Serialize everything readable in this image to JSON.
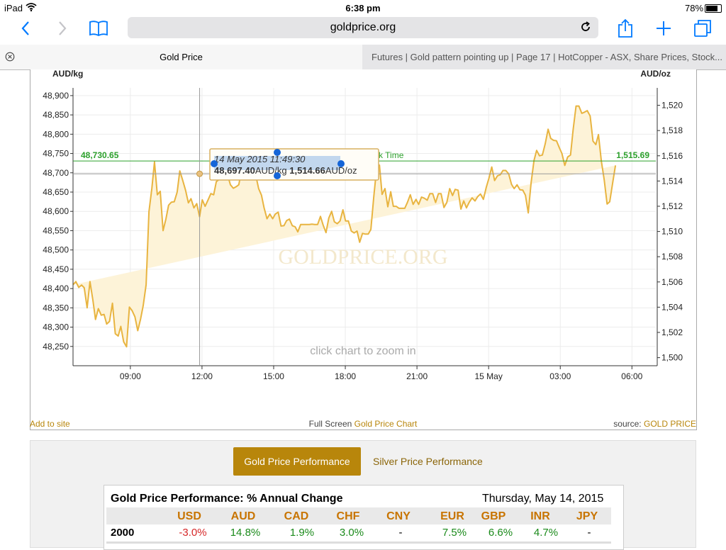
{
  "status_bar": {
    "carrier": "iPad",
    "time": "6:38 pm",
    "battery": "78%",
    "battery_level": 0.78
  },
  "browser": {
    "url": "goldprice.org",
    "tabs": [
      {
        "title": "Gold Price",
        "active": true
      },
      {
        "title": "Futures | Gold pattern pointing up | Page 17 | HotCopper - ASX, Share Prices, Stock...",
        "active": false
      }
    ]
  },
  "icons": {
    "back": "chevron-left-icon",
    "forward": "chevron-right-icon",
    "bookmarks": "book-icon",
    "reload": "reload-icon",
    "share": "share-icon",
    "new_tab": "plus-icon",
    "tabs": "tabs-icon",
    "close_tab": "close-icon",
    "wifi": "wifi-icon",
    "battery": "battery-icon"
  },
  "colors": {
    "accent": "#007aff",
    "gold_line": "#e8b440",
    "gold_fill": "#fdf3d8",
    "gold_brand": "#b8860b",
    "level_green": "#2ca02c",
    "marker_blue": "#1565d8"
  },
  "chart_data": {
    "type": "area",
    "left_axis_label": "AUD/kg",
    "right_axis_label": "AUD/oz",
    "ylim_left": [
      48200,
      48920
    ],
    "ylim_right": [
      1499.36,
      1521.38
    ],
    "y_ticks_left": [
      "48,250",
      "48,300",
      "48,350",
      "48,400",
      "48,450",
      "48,500",
      "48,550",
      "48,600",
      "48,650",
      "48,700",
      "48,750",
      "48,800",
      "48,850",
      "48,900"
    ],
    "y_ticks_right": [
      "1,500",
      "1,502",
      "1,504",
      "1,506",
      "1,508",
      "1,510",
      "1,512",
      "1,514",
      "1,516",
      "1,518",
      "1,520"
    ],
    "x_tick_labels": [
      "09:00",
      "12:00",
      "15:00",
      "18:00",
      "21:00",
      "15 May",
      "03:00",
      "06:00"
    ],
    "x_tick_hours": [
      9,
      12,
      15,
      18,
      21,
      24,
      27,
      30
    ],
    "xlim_hours": [
      6.6,
      31.0
    ],
    "series": [
      {
        "x_hours": [
          6.6,
          6.72,
          6.84,
          6.96,
          7.07,
          7.19,
          7.31,
          7.43,
          7.54,
          7.66,
          7.78,
          7.9,
          8.01,
          8.13,
          8.25,
          8.37,
          8.49,
          8.6,
          8.72,
          8.84,
          8.96,
          9.07,
          9.19,
          9.31,
          9.43,
          9.54,
          9.66,
          9.78,
          9.9,
          10.01,
          10.13,
          10.25,
          10.37,
          10.49,
          10.6,
          10.72,
          10.84,
          10.96,
          11.07,
          11.19,
          11.31,
          11.43,
          11.54,
          11.66,
          11.78,
          11.9,
          12.01,
          12.13,
          12.25,
          12.37,
          12.49,
          12.6,
          12.72,
          12.84,
          12.96,
          13.07,
          13.19,
          13.31,
          13.43,
          13.54,
          13.66,
          13.78,
          13.9,
          14.01,
          14.13,
          14.25,
          14.37,
          14.49,
          14.6,
          14.72,
          14.84,
          14.96,
          15.07,
          15.19,
          15.31,
          15.43,
          15.54,
          15.66,
          15.78,
          15.9,
          16.01,
          16.13,
          16.25,
          16.37,
          16.49,
          16.6,
          16.72,
          16.84,
          16.96,
          17.07,
          17.19,
          17.31,
          17.43,
          17.54,
          17.66,
          17.78,
          17.9,
          18.01,
          18.13,
          18.25,
          18.37,
          18.49,
          18.6,
          18.72,
          18.84,
          18.96,
          19.07,
          19.19,
          19.31,
          19.43,
          19.54,
          19.66,
          19.78,
          19.9,
          20.01,
          20.13,
          20.25,
          20.37,
          20.49,
          20.6,
          20.72,
          20.84,
          20.96,
          21.07,
          21.19,
          21.31,
          21.43,
          21.54,
          21.66,
          21.78,
          21.9,
          22.01,
          22.13,
          22.25,
          22.37,
          22.49,
          22.6,
          22.72,
          22.84,
          22.96,
          23.07,
          23.19,
          23.31,
          23.43,
          23.54,
          23.66,
          23.78,
          23.9,
          24.01,
          24.13,
          24.25,
          24.37,
          24.49,
          24.6,
          24.72,
          24.84,
          24.96,
          25.07,
          25.19,
          25.31,
          25.43,
          25.54,
          25.66,
          25.78,
          25.9,
          26.01,
          26.13,
          26.25,
          26.37,
          26.49,
          26.6,
          26.72,
          26.84,
          26.96,
          27.07,
          27.19,
          27.31,
          27.43,
          27.54,
          27.66,
          27.78,
          27.9,
          28.01,
          28.13,
          28.25,
          28.37,
          28.49,
          28.6,
          28.72,
          28.84,
          28.96,
          29.07,
          29.19,
          29.31,
          29.43,
          29.54,
          29.66,
          29.78,
          29.9,
          30.01,
          30.13,
          30.25,
          30.37,
          30.49,
          30.6,
          30.72,
          30.84
        ],
        "y_left": [
          48410,
          48418,
          48403,
          48409,
          48402,
          48350,
          48418,
          48370,
          48320,
          48348,
          48331,
          48333,
          48308,
          48315,
          48362,
          48283,
          48277,
          48302,
          48262,
          48249,
          48352,
          48343,
          48327,
          48291,
          48321,
          48356,
          48410,
          48599,
          48660,
          48728,
          48643,
          48652,
          48550,
          48580,
          48616,
          48624,
          48625,
          48650,
          48705,
          48681,
          48655,
          48622,
          48633,
          48609,
          48620,
          48586,
          48630,
          48613,
          48629,
          48646,
          48643,
          48677,
          48683,
          48687,
          48686,
          48694,
          48669,
          48660,
          48664,
          48669,
          48708,
          48693,
          48697,
          48716,
          48719,
          48694,
          48659,
          48642,
          48609,
          48581,
          48593,
          48581,
          48593,
          48598,
          48562,
          48563,
          48576,
          48580,
          48563,
          48560,
          48547,
          48566,
          48566,
          48566,
          48566,
          48567,
          48566,
          48566,
          48587,
          48565,
          48545,
          48583,
          48600,
          48573,
          48568,
          48575,
          48604,
          48575,
          48575,
          48549,
          48544,
          48549,
          48520,
          48543,
          48541,
          48541,
          48553,
          48636,
          48711,
          48720,
          48644,
          48659,
          48612,
          48651,
          48613,
          48613,
          48608,
          48608,
          48608,
          48623,
          48643,
          48618,
          48631,
          48618,
          48637,
          48634,
          48629,
          48646,
          48646,
          48623,
          48646,
          48646,
          48610,
          48623,
          48659,
          48641,
          48657,
          48655,
          48606,
          48627,
          48609,
          48624,
          48635,
          48627,
          48638,
          48645,
          48631,
          48662,
          48685,
          48715,
          48680,
          48692,
          48695,
          48706,
          48706,
          48697,
          48670,
          48659,
          48669,
          48656,
          48655,
          48642,
          48596,
          48674,
          48732,
          48758,
          48744,
          48746,
          48775,
          48813,
          48789,
          48784,
          48783,
          48765,
          48750,
          48719,
          48741,
          48746,
          48812,
          48873,
          48873,
          48854,
          48857,
          48861,
          48847,
          48782,
          48773,
          48799,
          48730,
          48682,
          48619,
          48625,
          48672,
          48719
        ],
        "stroke": "#e8b440",
        "fill": "#fdf3d8"
      }
    ],
    "level_line": {
      "left_label": "48,730.65",
      "right_label": "1,515.69",
      "note": "06:00 New York Time",
      "value_left": 48730.65
    },
    "crosshair": {
      "x_hours": 11.9,
      "y_left": 48697.4
    },
    "tooltip": {
      "date": "14 May 2015 11:49:30",
      "aud_kg": "48,697.40",
      "aud_kg_unit": "AUD/kg",
      "aud_oz": "1,514.66",
      "aud_oz_unit": "AUD/oz"
    },
    "watermark": "GOLDPRICE.ORG",
    "zoom_hint": "click chart to zoom in"
  },
  "chart_footer": {
    "add_to_site": "Add to site",
    "full_screen": "Full Screen",
    "chart_link": "Gold Price Chart",
    "source_label": "source:",
    "source_value": "GOLD PRICE"
  },
  "performance": {
    "tabs": [
      {
        "label": "Gold Price Performance",
        "active": true
      },
      {
        "label": "Silver Price Performance",
        "active": false
      }
    ],
    "title": "Gold Price Performance: % Annual Change",
    "date": "Thursday, May 14, 2015",
    "columns": [
      "USD",
      "AUD",
      "CAD",
      "CHF",
      "CNY",
      "EUR",
      "GBP",
      "INR",
      "JPY"
    ],
    "rows": [
      {
        "year": "2000",
        "values": [
          "-3.0%",
          "14.8%",
          "1.9%",
          "3.0%",
          "-",
          "7.5%",
          "6.6%",
          "4.7%",
          "-"
        ],
        "colors": [
          "#d62728",
          "#1a8a1a",
          "#1a8a1a",
          "#1a8a1a",
          "#000000",
          "#1a8a1a",
          "#1a8a1a",
          "#1a8a1a",
          "#000000"
        ]
      }
    ]
  }
}
